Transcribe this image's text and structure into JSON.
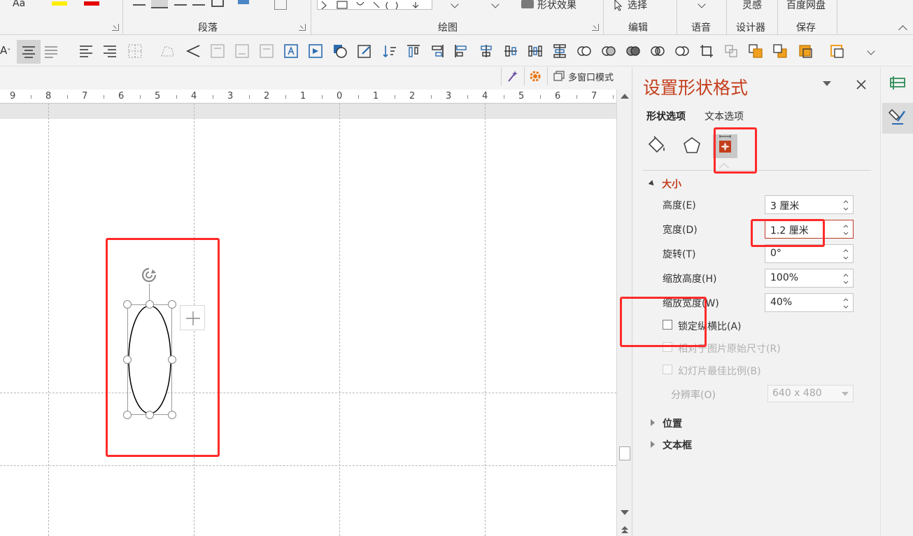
{
  "ribbon": {
    "top_texts": [
      "Aa",
      "形状效果",
      "选择",
      "灵感",
      "百度网盘"
    ],
    "groups": [
      "段落",
      "绘图",
      "编辑",
      "语音",
      "设计器",
      "保存"
    ]
  },
  "modebar": {
    "window_mode_label": "多窗口模式"
  },
  "ruler": {
    "numbers": [
      "9",
      "8",
      "7",
      "6",
      "5",
      "4",
      "3",
      "2",
      "1",
      "0",
      "1",
      "2",
      "3",
      "4",
      "5",
      "6",
      "7"
    ]
  },
  "pane": {
    "title": "设置形状格式",
    "tabs": [
      "形状选项",
      "文本选项"
    ],
    "size_section": "大小",
    "fields": [
      {
        "label": "高度(E)",
        "value": "3 厘米"
      },
      {
        "label": "宽度(D)",
        "value": "1.2 厘米"
      },
      {
        "label": "旋转(T)",
        "value": "0°"
      },
      {
        "label": "缩放高度(H)",
        "value": "100%"
      },
      {
        "label": "缩放宽度(W)",
        "value": "40%"
      }
    ],
    "checkboxes": [
      {
        "label": "锁定纵横比(A)",
        "checked": false,
        "disabled": false
      },
      {
        "label": "相对于图片原始尺寸(R)",
        "checked": false,
        "disabled": true
      },
      {
        "label": "幻灯片最佳比例(B)",
        "checked": false,
        "disabled": true
      }
    ],
    "resolution_label": "分辨率(O)",
    "resolution_value": "640 x 480",
    "position_section": "位置",
    "textbox_section": "文本框"
  },
  "colors": {
    "accent": "#c43e1c",
    "annotation": "#ff2a2a",
    "size_icon_bg": "#c43e1c"
  }
}
